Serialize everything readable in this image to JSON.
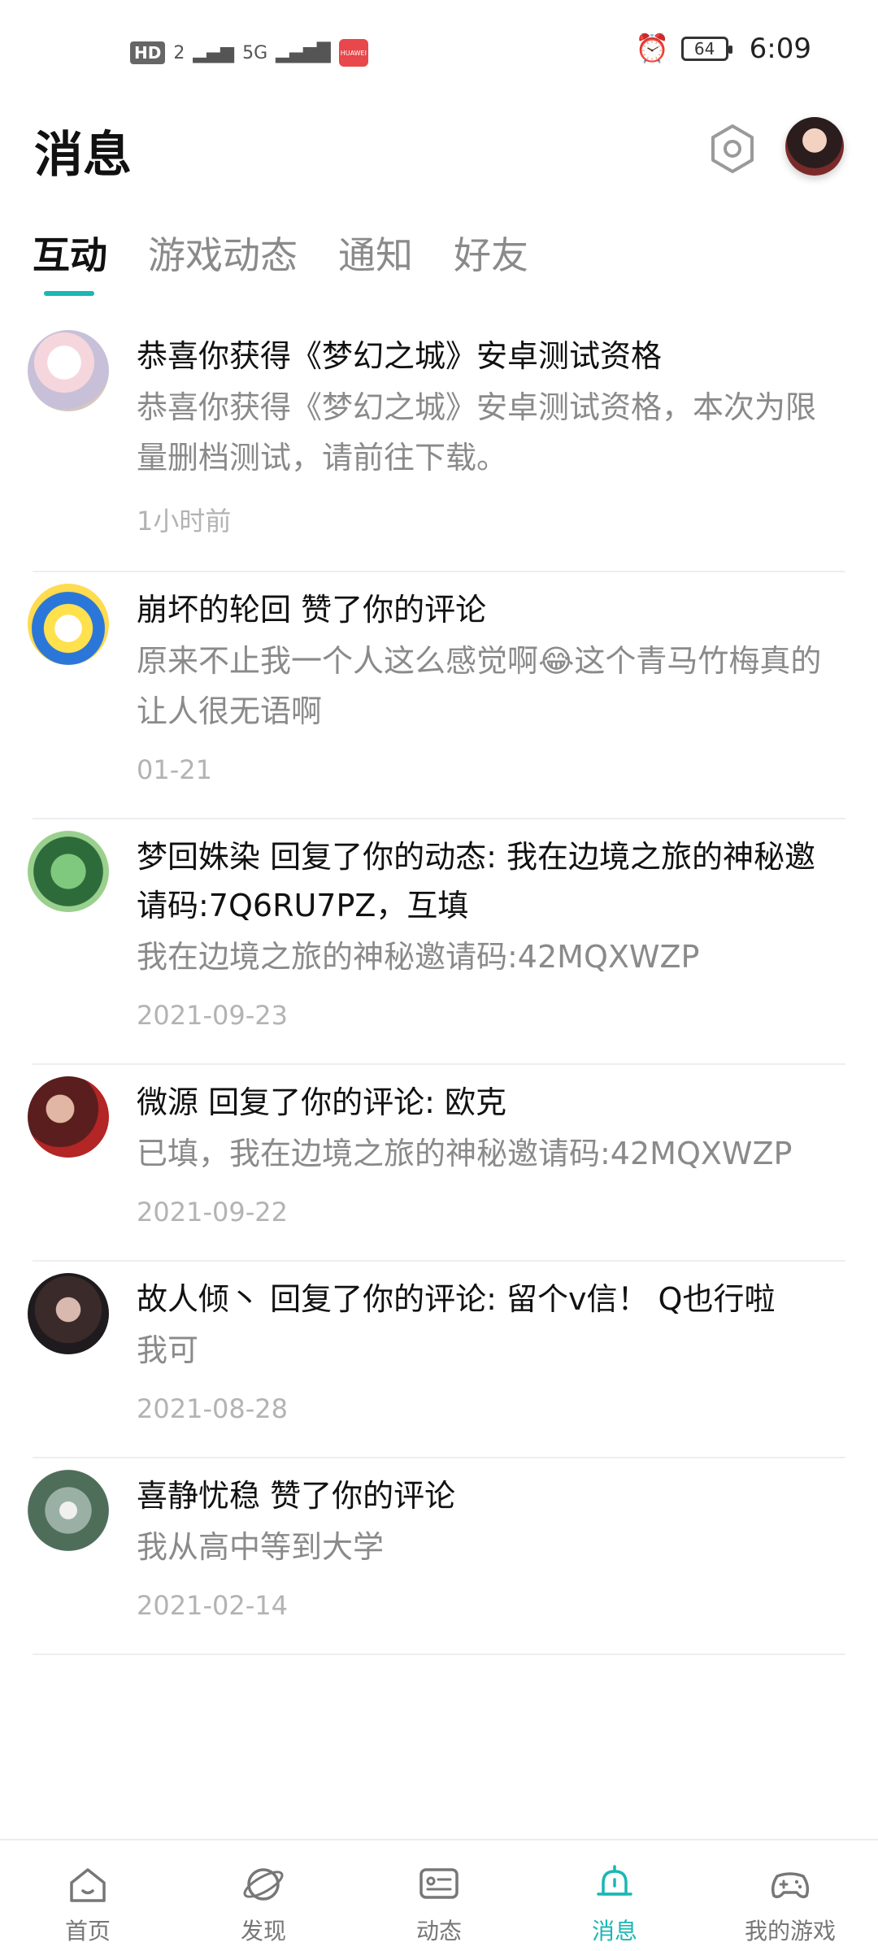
{
  "status_bar": {
    "hd_badge": "HD",
    "sim_indicator": "2",
    "network": "5G",
    "battery": "64",
    "time": "6:09"
  },
  "header": {
    "title": "消息"
  },
  "tabs": [
    {
      "label": "互动",
      "active": true
    },
    {
      "label": "游戏动态",
      "active": false
    },
    {
      "label": "通知",
      "active": false
    },
    {
      "label": "好友",
      "active": false
    }
  ],
  "messages": [
    {
      "title": "恭喜你获得《梦幻之城》安卓测试资格",
      "snippet": "恭喜你获得《梦幻之城》安卓测试资格，本次为限量删档测试，请前往下载。",
      "time": "1小时前"
    },
    {
      "title": "崩坏的轮回 赞了你的评论",
      "snippet": "原来不止我一个人这么感觉啊😂这个青马竹梅真的让人很无语啊",
      "time": "01-21"
    },
    {
      "title": "梦回姝染 回复了你的动态: 我在边境之旅的神秘邀请码:7Q6RU7PZ，互填",
      "snippet": "我在边境之旅的神秘邀请码:42MQXWZP",
      "time": "2021-09-23"
    },
    {
      "title": "微源 回复了你的评论: 欧克",
      "snippet": "已填，我在边境之旅的神秘邀请码:42MQXWZP",
      "time": "2021-09-22"
    },
    {
      "title": "故人倾丶 回复了你的评论: 留个v信！ Q也行啦",
      "snippet": "我可",
      "time": "2021-08-28"
    },
    {
      "title": "喜静忧稳 赞了你的评论",
      "snippet": "我从高中等到大学",
      "time": "2021-02-14"
    }
  ],
  "bottom_nav": [
    {
      "label": "首页",
      "icon": "home-icon",
      "active": false
    },
    {
      "label": "发现",
      "icon": "discover-icon",
      "active": false
    },
    {
      "label": "动态",
      "icon": "feed-icon",
      "active": false
    },
    {
      "label": "消息",
      "icon": "bell-icon",
      "active": true
    },
    {
      "label": "我的游戏",
      "icon": "gamepad-icon",
      "active": false
    }
  ],
  "colors": {
    "accent": "#1ab7b3",
    "text_primary": "#111111",
    "text_secondary": "#8a8a8a",
    "text_time": "#b3b3b3"
  }
}
